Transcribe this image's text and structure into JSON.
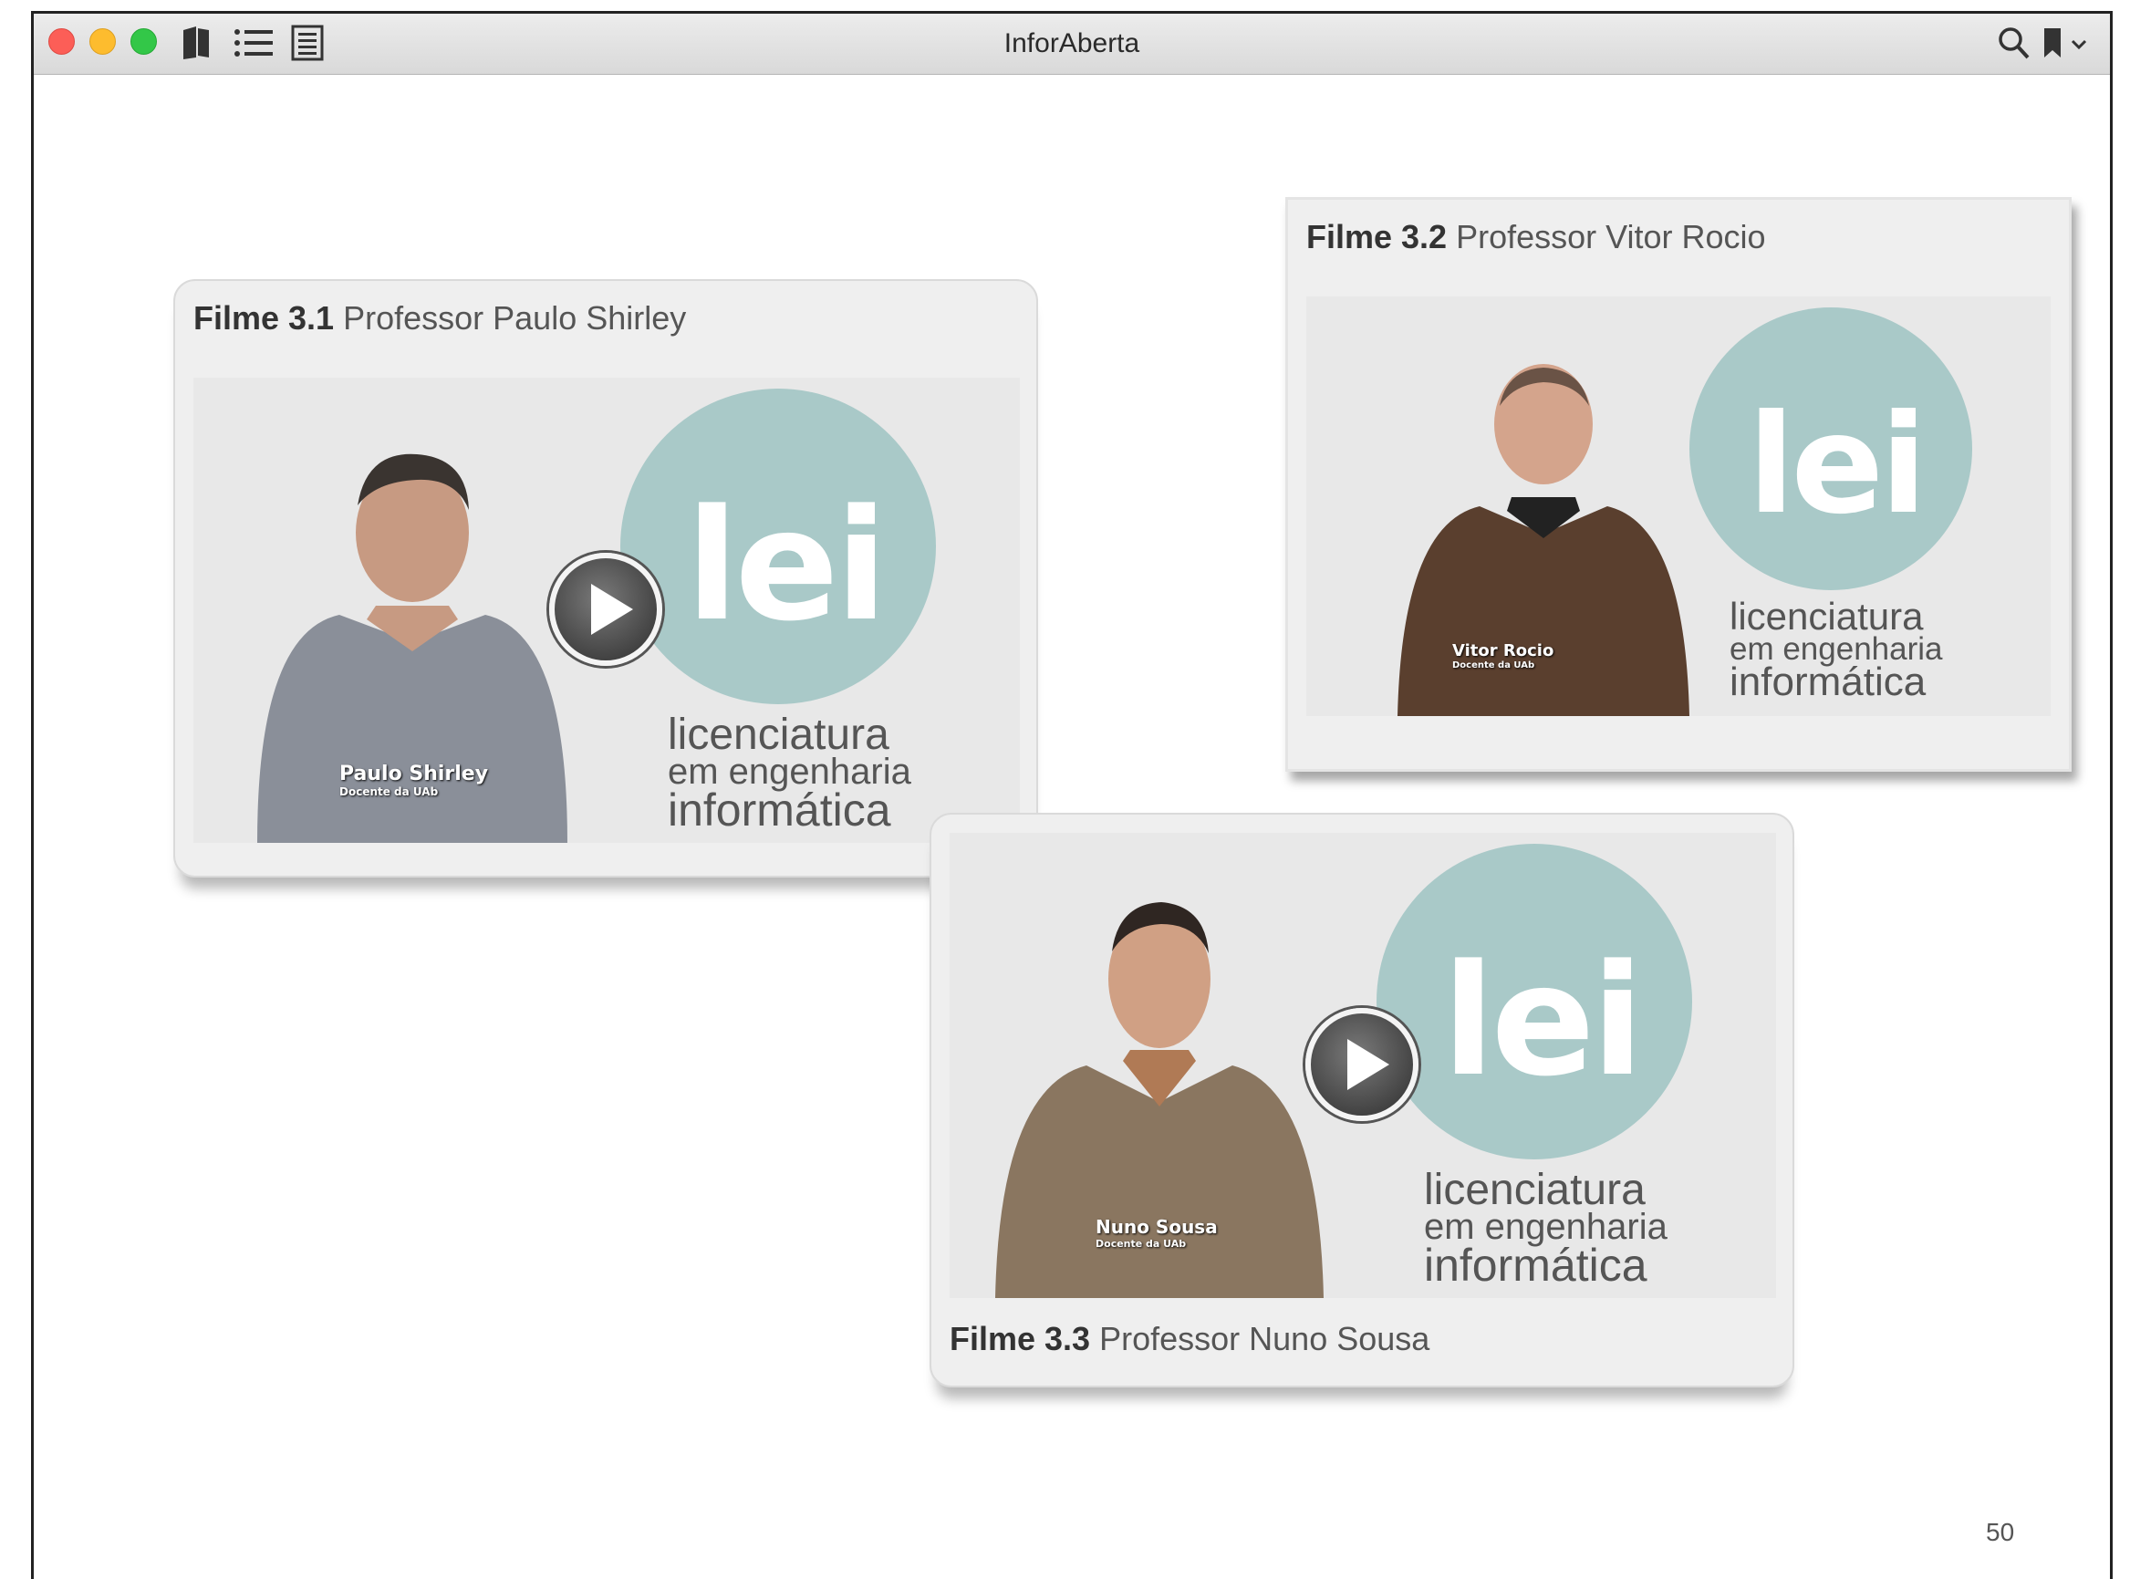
{
  "window": {
    "title": "InforAberta",
    "colors": {
      "close": "#fc5e57",
      "minimize": "#fdbc2e",
      "maximize": "#33c748"
    },
    "toolbar_icons": [
      "book-icon",
      "list-icon",
      "notes-icon",
      "search-icon",
      "bookmark-icon",
      "chevron-down-icon"
    ]
  },
  "films": [
    {
      "number": "Filme 3.1",
      "title": "Professor Paulo Shirley",
      "presenter_name": "Paulo Shirley",
      "presenter_role": "Docente da UAb"
    },
    {
      "number": "Filme 3.2",
      "title": "Professor Vitor Rocio",
      "presenter_name": "Vitor Rocio",
      "presenter_role": "Docente da UAb"
    },
    {
      "number": "Filme 3.3",
      "title": "Professor Nuno Sousa",
      "presenter_name": "Nuno Sousa",
      "presenter_role": "Docente da UAb"
    }
  ],
  "logo": {
    "word": "lei",
    "line1": "licenciatura",
    "line2": "em engenharia",
    "line3": "informática",
    "color": "#a9c9c8"
  },
  "page_number": "50"
}
